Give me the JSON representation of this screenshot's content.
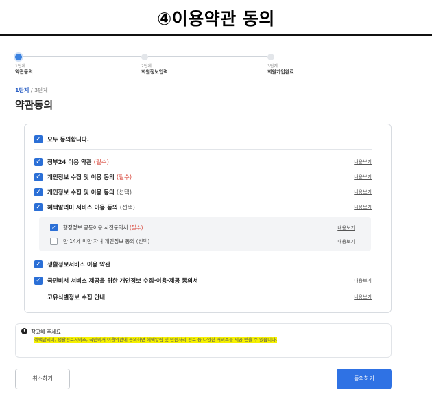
{
  "header": {
    "title": "④이용약관 동의"
  },
  "stepper": {
    "steps": [
      {
        "num": "1단계",
        "label": "약관동의"
      },
      {
        "num": "2단계",
        "label": "회원정보입력"
      },
      {
        "num": "3단계",
        "label": "회원가입완료"
      }
    ]
  },
  "step_indicator": {
    "current": "1단계",
    "total": " / 3단계"
  },
  "page_title": "약관동의",
  "agree_all": {
    "label": "모두 동의합니다.",
    "checked": true
  },
  "terms": [
    {
      "label": "정부24 이용 약관",
      "tag": "(필수)",
      "tag_type": "req",
      "link": "내용보기",
      "checked": true
    },
    {
      "label": "개인정보 수집 및 이용 동의",
      "tag": "(필수)",
      "tag_type": "req",
      "link": "내용보기",
      "checked": true
    },
    {
      "label": "개인정보 수집 및 이용 동의",
      "tag": "(선택)",
      "tag_type": "opt",
      "link": "내용보기",
      "checked": true
    },
    {
      "label": "혜택알리미 서비스 이용 동의",
      "tag": "(선택)",
      "tag_type": "opt",
      "link": "내용보기",
      "checked": true
    }
  ],
  "sub_terms": [
    {
      "label": "행정정보 공동이용 사전동의서",
      "tag": "(필수)",
      "tag_type": "req",
      "link": "내용보기",
      "checked": true
    },
    {
      "label": "만 14세 미만 자녀 개인정보 동의",
      "tag": "(선택)",
      "tag_type": "opt",
      "link": "내용보기",
      "checked": false
    }
  ],
  "terms_more": [
    {
      "label": "생활정보서비스 이용 약관",
      "tag": "",
      "tag_type": "opt",
      "link": "",
      "checked": true
    },
    {
      "label": "국민비서 서비스 제공을 위한 개인정보 수집·이용·제공 동의서",
      "tag": "",
      "tag_type": "opt",
      "link": "내용보기",
      "checked": true
    },
    {
      "label": "고유식별정보 수집 안내",
      "tag": "",
      "tag_type": "opt",
      "link": "내용보기",
      "checked": null
    }
  ],
  "note": {
    "icon": "info-icon",
    "title": "참고해 주세요",
    "text": "혜택알리미, 생활정보서비스, 국민비서 이용약관에 동의하면 혜택알림 및 민원처리 정보 등 다양한 서비스를 제공 받을 수 있습니다."
  },
  "buttons": {
    "cancel": "취소하기",
    "agree": "동의하기"
  },
  "colors": {
    "accent": "#2f72e4",
    "required": "#d8463a",
    "highlight": "#f5f100"
  }
}
